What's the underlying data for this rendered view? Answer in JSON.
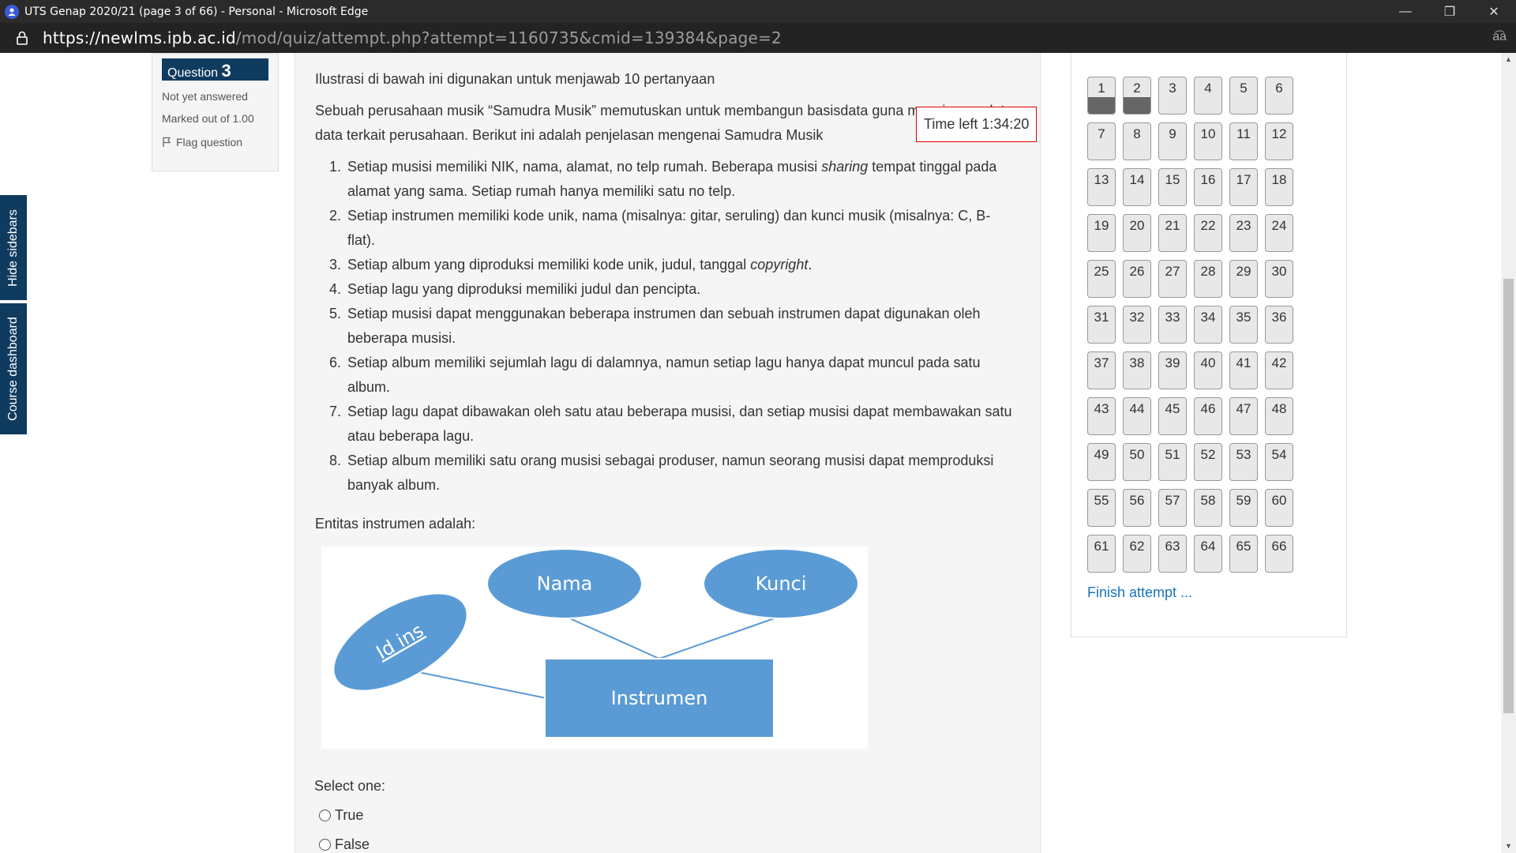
{
  "window": {
    "title": "UTS Genap 2020/21 (page 3 of 66) - Personal - Microsoft Edge",
    "minimize": "—",
    "restore": "❐",
    "close": "✕"
  },
  "address": {
    "scheme": "https://",
    "host": "newlms.ipb.ac.id",
    "path": "/mod/quiz/attempt.php?attempt=1160735&cmid=139384&page=2",
    "read_aloud": "a͡a"
  },
  "sidebar_tabs": {
    "hide": "Hide sidebars",
    "course": "Course dashboard"
  },
  "question_info": {
    "prefix": "Question",
    "number": "3",
    "status": "Not yet answered",
    "marked": "Marked out of 1.00",
    "flag": "Flag question"
  },
  "timer": "Time left 1:34:20",
  "question": {
    "intro": "Ilustrasi di bawah ini digunakan untuk menjawab 10 pertanyaan",
    "context": "Sebuah perusahaan musik “Samudra Musik” memutuskan untuk membangun basisdata guna menyimpan data-data terkait perusahaan. Berikut ini adalah penjelasan mengenai Samudra Musik",
    "items": [
      {
        "a": "Setiap musisi memiliki NIK, nama, alamat, no telp rumah. Beberapa musisi ",
        "i": "sharing",
        "b": " tempat tinggal pada alamat yang sama. Setiap rumah hanya memiliki satu no telp."
      },
      {
        "a": "Setiap instrumen memiliki kode unik, nama (misalnya: gitar, seruling) dan kunci musik (misalnya: C, B-flat).",
        "i": "",
        "b": ""
      },
      {
        "a": "Setiap album yang diproduksi memiliki kode unik, judul, tanggal ",
        "i": "copyright",
        "b": "."
      },
      {
        "a": "Setiap lagu yang diproduksi memiliki judul dan pencipta.",
        "i": "",
        "b": ""
      },
      {
        "a": "Setiap musisi dapat menggunakan beberapa instrumen dan sebuah instrumen dapat digunakan oleh beberapa musisi.",
        "i": "",
        "b": ""
      },
      {
        "a": "Setiap album memiliki sejumlah lagu di dalamnya, namun setiap lagu hanya dapat muncul pada satu album.",
        "i": "",
        "b": ""
      },
      {
        "a": "Setiap lagu dapat dibawakan oleh satu atau beberapa musisi, dan setiap musisi dapat membawakan satu atau beberapa lagu.",
        "i": "",
        "b": ""
      },
      {
        "a": "Setiap album memiliki satu orang musisi sebagai produser, namun seorang musisi dapat memproduksi banyak album.",
        "i": "",
        "b": ""
      }
    ],
    "prompt": "Entitas instrumen adalah:",
    "diagram": {
      "entity": "Instrumen",
      "attr_key": "Id ins",
      "attr1": "Nama",
      "attr2": "Kunci",
      "color": "#5b9bd5"
    },
    "select_label": "Select one:",
    "options": [
      "True",
      "False"
    ]
  },
  "nav": {
    "answered": [
      "1",
      "2"
    ],
    "finish": "Finish attempt ..."
  },
  "colors": {
    "brand": "#0f3b5f",
    "link": "#1a74b8",
    "timer_border": "#dd0000"
  }
}
